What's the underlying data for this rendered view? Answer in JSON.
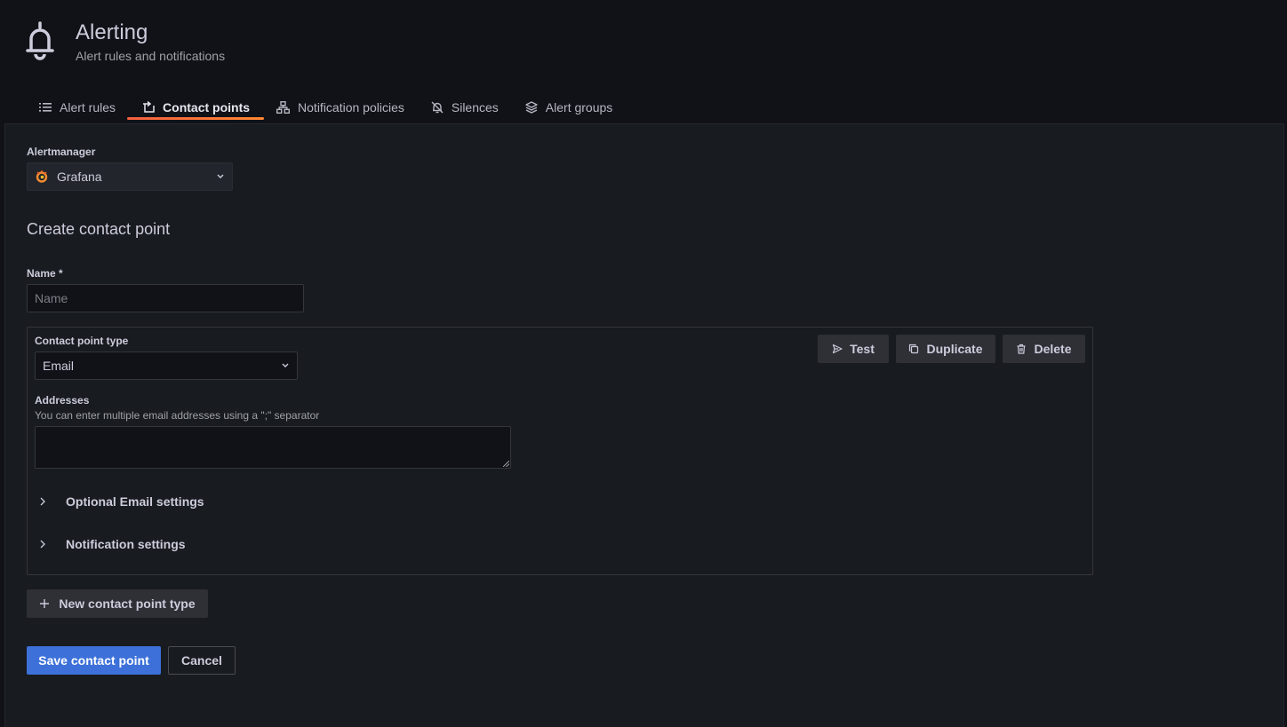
{
  "header": {
    "title": "Alerting",
    "subtitle": "Alert rules and notifications",
    "icon": "bell-icon"
  },
  "tabs": [
    {
      "label": "Alert rules",
      "icon": "list-icon",
      "active": false
    },
    {
      "label": "Contact points",
      "icon": "comment-alt-share-icon",
      "active": true
    },
    {
      "label": "Notification policies",
      "icon": "sitemap-icon",
      "active": false
    },
    {
      "label": "Silences",
      "icon": "bell-slash-icon",
      "active": false
    },
    {
      "label": "Alert groups",
      "icon": "layer-group-icon",
      "active": false
    }
  ],
  "alertmanager": {
    "label": "Alertmanager",
    "value": "Grafana",
    "icon": "grafana-logo"
  },
  "form": {
    "title": "Create contact point",
    "name_label": "Name *",
    "name_placeholder": "Name",
    "name_value": "",
    "contact_point_type_label": "Contact point type",
    "contact_point_type_value": "Email",
    "addresses_label": "Addresses",
    "addresses_help": "You can enter multiple email addresses using a \";\" separator",
    "addresses_value": "",
    "optional_settings": "Optional Email settings",
    "notification_settings": "Notification settings"
  },
  "actions": {
    "test": "Test",
    "duplicate": "Duplicate",
    "delete": "Delete",
    "new_type": "New contact point type",
    "save": "Save contact point",
    "cancel": "Cancel"
  },
  "colors": {
    "background": "#111217",
    "panel": "#181b1f",
    "primary": "#3d71d9",
    "tab_accent": "#f55f3e"
  }
}
